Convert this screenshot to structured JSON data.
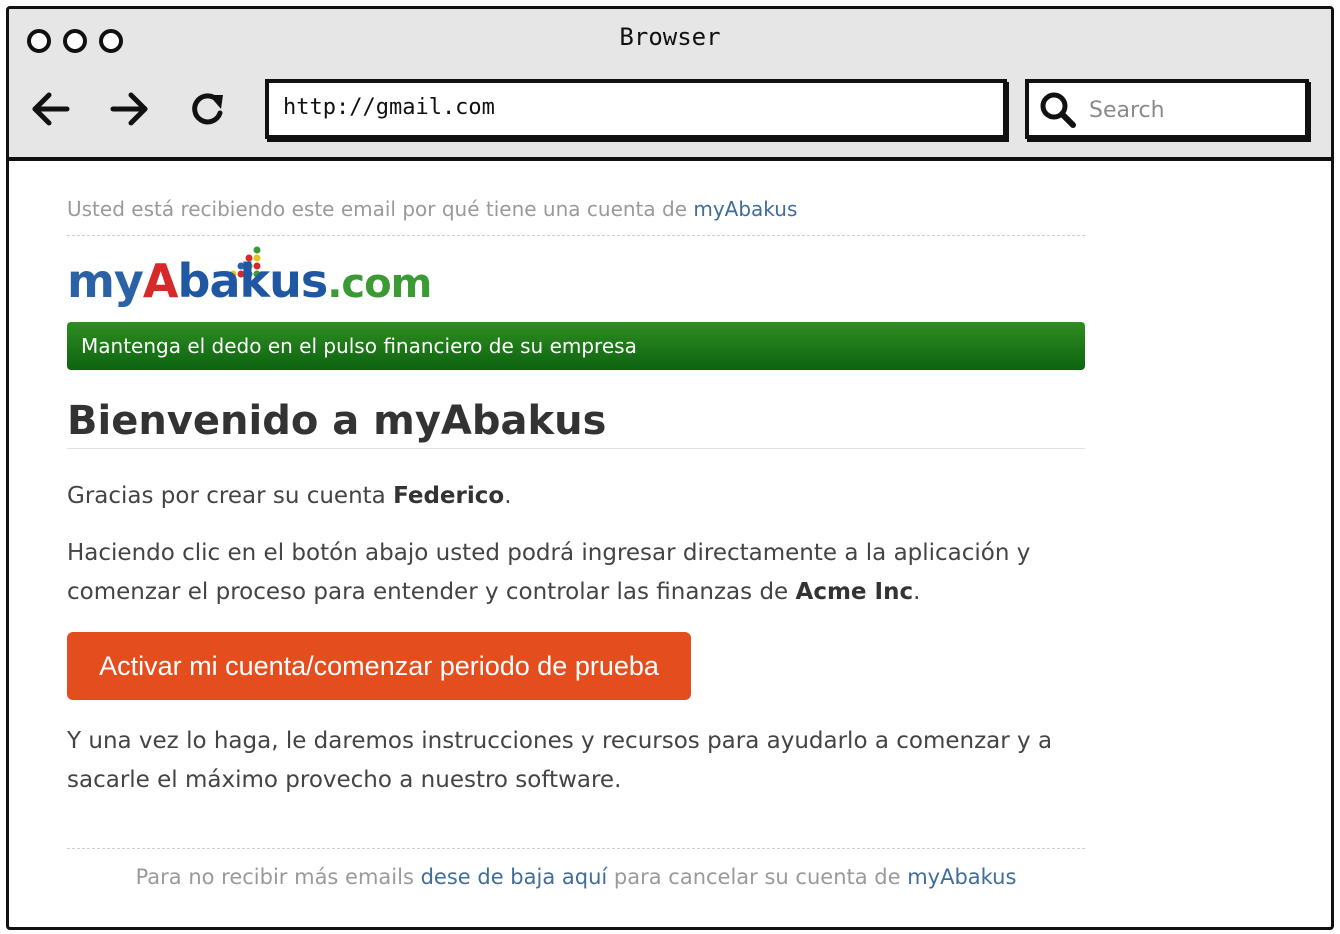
{
  "browser": {
    "title": "Browser",
    "url": "http://gmail.com",
    "search_placeholder": "Search"
  },
  "email": {
    "preheader_text": "Usted está recibiendo este email por qué tiene una cuenta de ",
    "preheader_link": "myAbakus",
    "logo": {
      "my": "my",
      "a": "A",
      "bakus": "bakus",
      "com": ".com"
    },
    "tagline": "Mantenga el dedo en el pulso financiero de su empresa",
    "heading": "Bienvenido a myAbakus",
    "greeting_prefix": "Gracias por crear su cuenta ",
    "user_name": "Federico",
    "greeting_suffix": ".",
    "body_prefix": "Haciendo clic en el botón abajo usted podrá ingresar directamente a la aplicación y comenzar el proceso para entender y controlar las finanzas de ",
    "company_name": "Acme Inc",
    "body_suffix": ".",
    "cta_label": "Activar mi cuenta/comenzar periodo de prueba",
    "followup": "Y una vez lo haga,  le daremos instrucciones y recursos para ayudarlo a comenzar y a sacarle el máximo provecho a nuestro software.",
    "footer_prefix": "Para no recibir más emails ",
    "footer_unsubscribe": "dese de baja aquí",
    "footer_middle": " para cancelar su cuenta de ",
    "footer_link": "myAbakus"
  },
  "colors": {
    "cta": "#e44e1f",
    "banner": "#1f7a18",
    "link": "#3f6d9c"
  }
}
